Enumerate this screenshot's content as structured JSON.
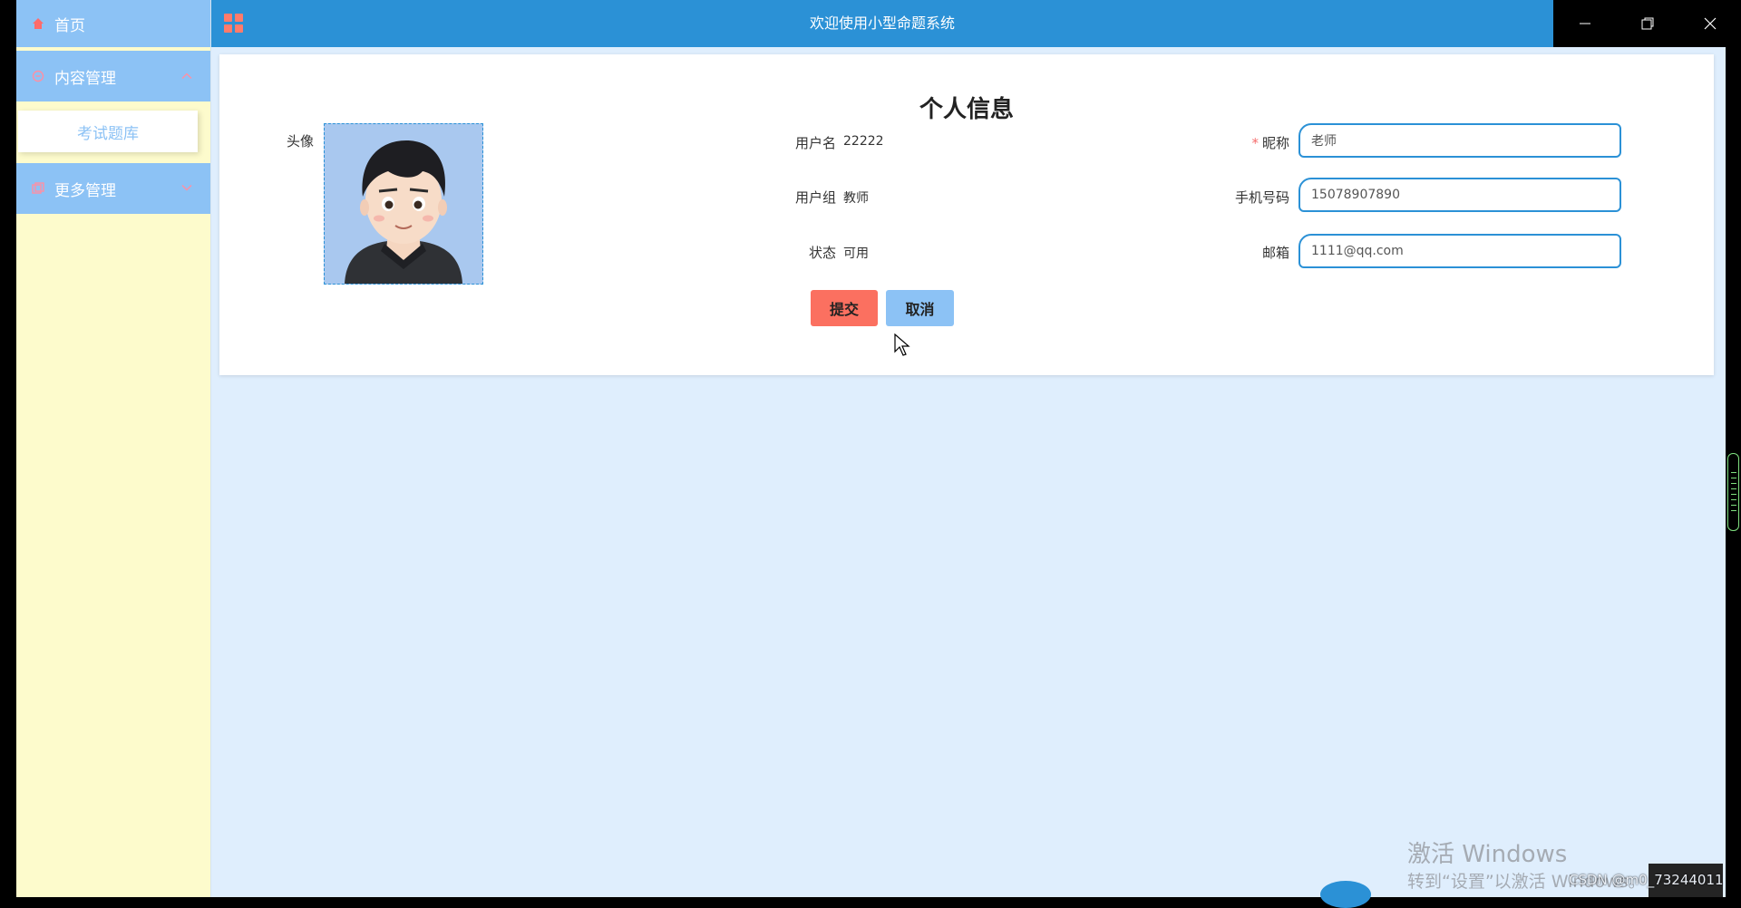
{
  "window": {
    "title": "欢迎使用小型命题系统"
  },
  "sidebar": {
    "items": [
      {
        "label": "首页",
        "icon": "home-icon"
      },
      {
        "label": "内容管理",
        "icon": "content-icon",
        "arrow": "up"
      },
      {
        "label": "考试题库"
      },
      {
        "label": "更多管理",
        "icon": "more-icon",
        "arrow": "down"
      }
    ]
  },
  "profile": {
    "title": "个人信息",
    "avatar_label": "头像",
    "username_label": "用户名",
    "username": "22222",
    "group_label": "用户组",
    "group": "教师",
    "status_label": "状态",
    "status": "可用",
    "nickname_required": "*",
    "nickname_label": "昵称",
    "nickname": "老师",
    "phone_label": "手机号码",
    "phone": "15078907890",
    "email_label": "邮箱",
    "email": "1111@qq.com",
    "submit_label": "提交",
    "cancel_label": "取消"
  },
  "watermark": {
    "line1": "激活 Windows",
    "line2": "转到“设置”以激活 Windows。",
    "csdn": "CSDN @m0_73244011"
  },
  "colors": {
    "sidebar_bg": "#fdfbcc",
    "menu_bg": "#8cc2f5",
    "topbar": "#2b91d6",
    "submit": "#fb7060",
    "cancel": "#8cc2f5",
    "content_bg": "#dfeefd"
  }
}
